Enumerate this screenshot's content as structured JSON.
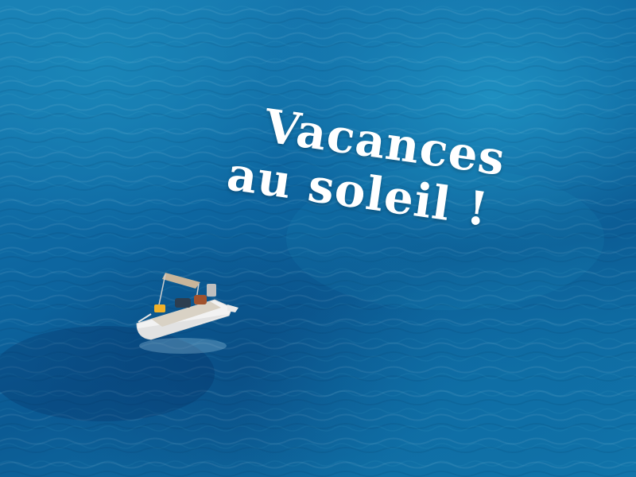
{
  "headline": {
    "line1": "Vacances",
    "line2": "au soleil !"
  },
  "colors": {
    "sea_light": "#1e8fc0",
    "sea_mid": "#0d66a0",
    "sea_dark": "#0a4f86",
    "text": "#ffffff",
    "boat_hull": "#f2f2f2",
    "bimini": "#c8b59a"
  },
  "icons": {
    "boat": "motorboat-icon"
  }
}
